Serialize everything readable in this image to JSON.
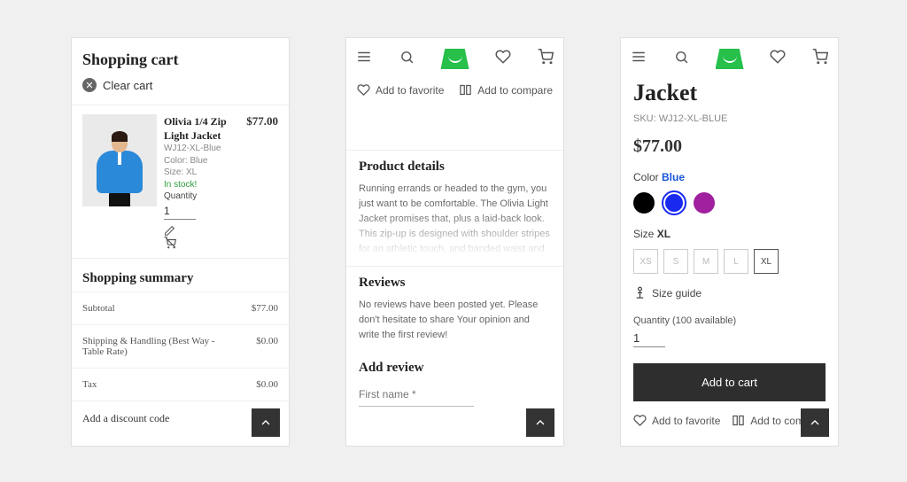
{
  "cart": {
    "title": "Shopping cart",
    "clear_label": "Clear cart",
    "item": {
      "name": "Olivia 1/4 Zip Light Jacket",
      "sku": "WJ12-XL-Blue",
      "color_line": "Color: Blue",
      "size_line": "Size: XL",
      "stock": "In stock!",
      "qty_label": "Quantity",
      "qty": "1",
      "price": "$77.00"
    },
    "summary_title": "Shopping summary",
    "rows": {
      "subtotal_label": "Subtotal",
      "subtotal_value": "$77.00",
      "ship_label": "Shipping & Handling (Best Way - Table Rate)",
      "ship_value": "$0.00",
      "tax_label": "Tax",
      "tax_value": "$0.00"
    },
    "discount_label": "Add a discount code"
  },
  "details": {
    "fav_label": "Add to favorite",
    "cmp_label": "Add to compare",
    "pd_title": "Product details",
    "pd_body": "Running errands or headed to the gym, you just want to be comfortable. The Olivia Light Jacket promises that, plus a laid-back look. This zip-up is designed with shoulder stripes for an athletic touch, and banded waist and",
    "rev_title": "Reviews",
    "rev_body": "No reviews have been posted yet. Please don't hesitate to share Your opinion and write the first review!",
    "add_rev_title": "Add review",
    "first_name_ph": "First name *"
  },
  "product": {
    "title": "Jacket",
    "sku_line": "SKU: WJ12-XL-BLUE",
    "price": "$77.00",
    "color_label": "Color ",
    "color_value": "Blue",
    "size_label": "Size ",
    "size_value": "XL",
    "sizes": [
      "XS",
      "S",
      "M",
      "L",
      "XL"
    ],
    "size_guide": "Size guide",
    "qty_line": "Quantity (100 available)",
    "qty": "1",
    "add_to_cart": "Add to cart",
    "fav_label": "Add to favorite",
    "cmp_label": "Add to compare"
  }
}
